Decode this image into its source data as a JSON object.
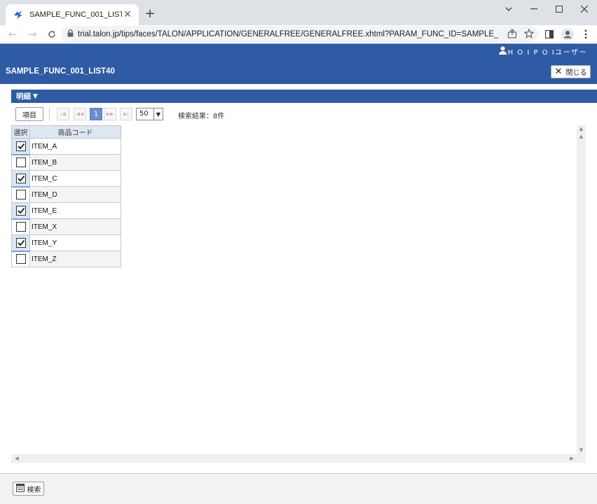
{
  "browser": {
    "tab_title": "SAMPLE_FUNC_001_LIST40",
    "url": "trial.talon.jp/tips/faces/TALON/APPLICATION/GENERALFREE/GENERALFREE.xhtml?PARAM_FUNC_ID=SAMPLE_FUNC_001..."
  },
  "app": {
    "user_name": "H O I P O Iユーザー",
    "screen_title": "SAMPLE_FUNC_001_LIST40",
    "close_label": "閉じる",
    "section_label": "明細"
  },
  "pager": {
    "item_button": "項目",
    "current_page": "1",
    "page_size": "50",
    "result_text": "検索結果：8件"
  },
  "grid": {
    "headers": {
      "select": "選択",
      "code": "商品コード"
    },
    "rows": [
      {
        "code": "ITEM_A",
        "checked": true
      },
      {
        "code": "ITEM_B",
        "checked": false
      },
      {
        "code": "ITEM_C",
        "checked": true
      },
      {
        "code": "ITEM_D",
        "checked": false
      },
      {
        "code": "ITEM_E",
        "checked": true
      },
      {
        "code": "ITEM_X",
        "checked": false
      },
      {
        "code": "ITEM_Y",
        "checked": true
      },
      {
        "code": "ITEM_Z",
        "checked": false
      }
    ]
  },
  "footer": {
    "search_label": "検索"
  },
  "colors": {
    "header_blue": "#2f5aa4",
    "page_current": "#6a8cd1"
  }
}
